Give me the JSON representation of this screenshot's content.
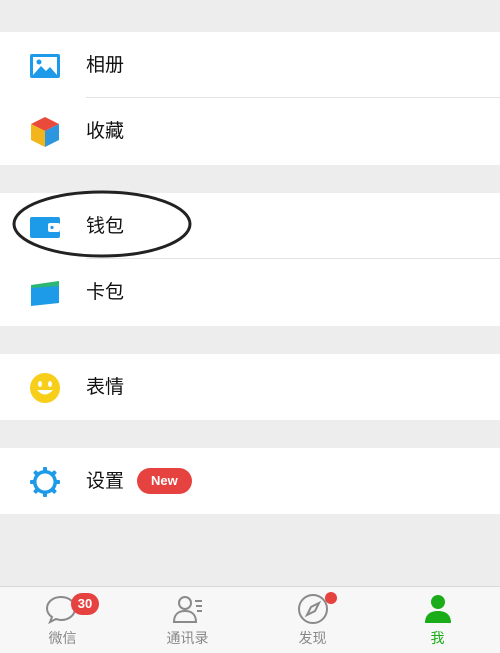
{
  "colors": {
    "background": "#ededed",
    "accent_green": "#1aad19",
    "badge_red": "#e64340",
    "icon_blue": "#1e9be8"
  },
  "menu": {
    "album": {
      "label": "相册",
      "icon": "album-icon"
    },
    "favorites": {
      "label": "收藏",
      "icon": "favorites-cube-icon"
    },
    "wallet": {
      "label": "钱包",
      "icon": "wallet-icon"
    },
    "cards": {
      "label": "卡包",
      "icon": "card-holder-icon"
    },
    "stickers": {
      "label": "表情",
      "icon": "smiley-icon"
    },
    "settings": {
      "label": "设置",
      "icon": "settings-gear-icon",
      "badge": "New"
    }
  },
  "tabbar": {
    "chats": {
      "label": "微信",
      "icon": "chat-bubble-icon",
      "badge": "30"
    },
    "contacts": {
      "label": "通讯录",
      "icon": "contacts-icon"
    },
    "discover": {
      "label": "发现",
      "icon": "compass-icon",
      "dot": true
    },
    "me": {
      "label": "我",
      "icon": "person-icon",
      "active": true
    }
  }
}
